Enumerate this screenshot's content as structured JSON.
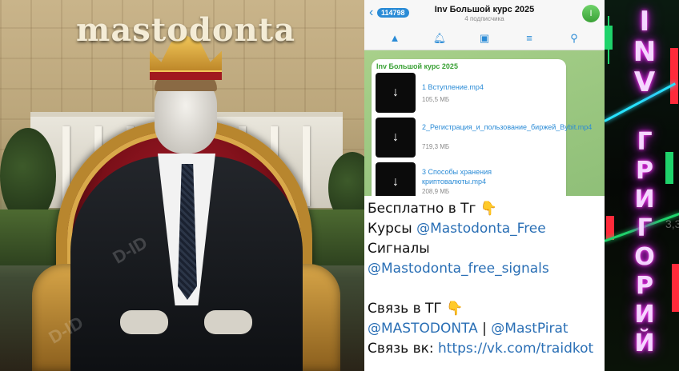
{
  "poster": {
    "brand": "mastodonta",
    "watermark": "D-ID"
  },
  "telegram": {
    "back_badge": "114798",
    "channel_title": "Inv Большой курс 2025",
    "subscribers": "4 подписчика",
    "avatar_letter": "I",
    "toolbar": [
      "pin-icon",
      "bell-icon",
      "image-icon",
      "stack-icon",
      "search-icon"
    ],
    "message_author": "Inv Большой курс 2025",
    "files": [
      {
        "name": "1 Вступление.mp4",
        "size": "105,5 МБ"
      },
      {
        "name": "2_Регистрация_и_пользование_биржей_Bybit.mp4",
        "size": "719,3 МБ"
      },
      {
        "name": "3 Способы хранения криптовалюты.mp4",
        "size": "208,9 МБ"
      }
    ]
  },
  "promo": {
    "line1": "Бесплатно в Тг 👇",
    "courses_label": "Курсы ",
    "courses_link": "@Mastodonta_Free",
    "signals_label": "Сигналы",
    "signals_link": "@Mastodonta_free_signals",
    "contact_label": "Связь в ТГ 👇",
    "contact_link1": "@MASTODONTA",
    "contact_sep": " | ",
    "contact_link2": "@MastPirat",
    "vk_label": "Связь вк: ",
    "vk_link": "https://vk.com/traidkot"
  },
  "strip": {
    "word1": [
      "I",
      "N",
      "V"
    ],
    "word2": [
      "Г",
      "Р",
      "И",
      "Г",
      "О",
      "Р",
      "И",
      "Й"
    ],
    "ghost_text": "3,3"
  },
  "colors": {
    "link_blue": "#2a6fb5",
    "telegram_blue": "#2a8bd6",
    "neon_pink": "#ff3bf0",
    "neon_cyan": "#27e3ff"
  }
}
